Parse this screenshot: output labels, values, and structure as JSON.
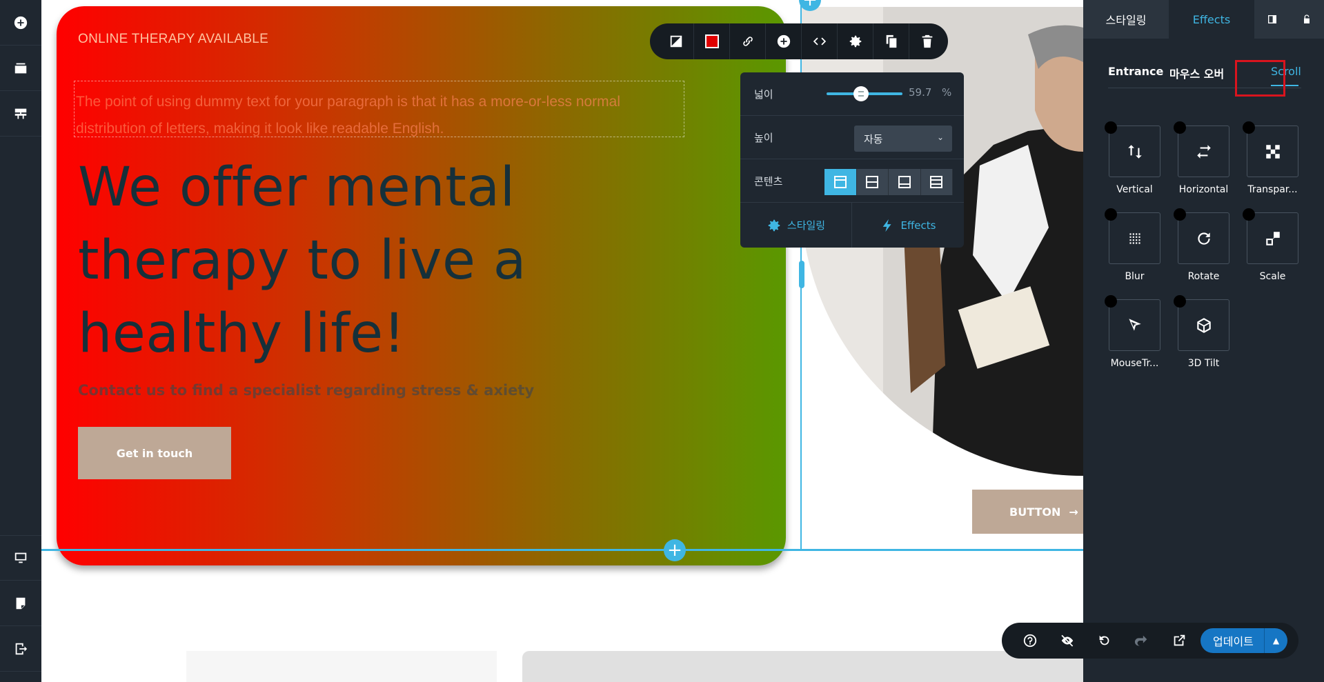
{
  "hero": {
    "eyebrow": "ONLINE THERAPY AVAILABLE",
    "paragraph": "The point of using dummy text for your paragraph is that it has a more-or-less normal distribution of letters, making it look like readable English.",
    "title": "We offer mental therapy to live a healthy life!",
    "subtitle": "Contact us to find a specialist regarding stress & axiety",
    "cta_label": "Get in touch"
  },
  "secondary_button": {
    "label": "BUTTON",
    "arrow": "→"
  },
  "dimension_popup": {
    "width_label": "넓이",
    "width_value": "59.7",
    "width_unit": "%",
    "width_fraction": 0.45,
    "height_label": "높이",
    "height_value": "자동",
    "content_label": "콘텐츠",
    "content_active_index": 0,
    "footer": [
      {
        "label": "스타일링",
        "icon": "gear-icon"
      },
      {
        "label": "Effects",
        "icon": "bolt-icon"
      }
    ]
  },
  "right_panel": {
    "tabs": [
      {
        "label": "스타일링",
        "active": false
      },
      {
        "label": "Effects",
        "active": true
      }
    ],
    "sub_tabs": [
      {
        "label": "Entrance",
        "active": false
      },
      {
        "label": "마우스 오버",
        "active": false
      },
      {
        "label": "Scroll",
        "active": true
      }
    ],
    "effects": [
      {
        "label": "Vertical",
        "icon": "vertical-arrows-icon"
      },
      {
        "label": "Horizontal",
        "icon": "horizontal-arrows-icon"
      },
      {
        "label": "Transpar...",
        "icon": "transparency-icon"
      },
      {
        "label": "Blur",
        "icon": "blur-icon"
      },
      {
        "label": "Rotate",
        "icon": "rotate-icon"
      },
      {
        "label": "Scale",
        "icon": "scale-icon"
      },
      {
        "label": "MouseTr...",
        "icon": "cursor-icon"
      },
      {
        "label": "3D Tilt",
        "icon": "cube-icon"
      }
    ]
  },
  "bottom_bar": {
    "update_label": "업데이트"
  },
  "colors": {
    "accent": "#3fb6e3",
    "panel": "#1f2730",
    "highlight": "#d9141e",
    "update": "#1676c4",
    "cta": "#bea896"
  }
}
